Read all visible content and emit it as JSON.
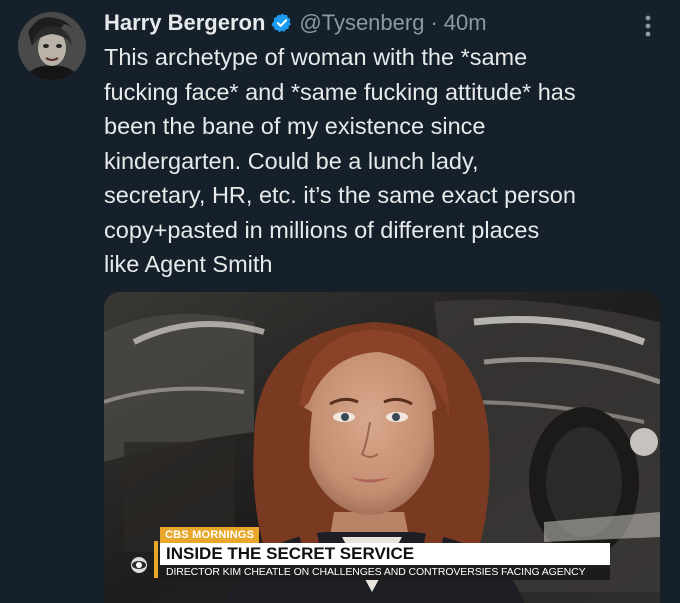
{
  "tweet": {
    "author": {
      "display_name": "Harry Bergeron",
      "handle": "@Tysenberg",
      "verified": true,
      "avatar_icon": "avatar-portrait"
    },
    "separator": "·",
    "timestamp": "40m",
    "more_icon": "more-vertical-icon",
    "text": "This archetype of woman with the *same\nfucking face* and *same fucking attitude* has\nbeen the bane of my existence since\nkindergarten. Could be a lunch lady,\nsecretary, HR, etc. it’s the same exact person\ncopy+pasted in millions of different places\nlike Agent Smith",
    "media": {
      "type": "video-still",
      "show_tag": "CBS MORNINGS",
      "headline": "INSIDE THE SECRET SERVICE",
      "subline": "DIRECTOR KIM CHEATLE ON CHALLENGES AND CONTROVERSIES FACING AGENCY"
    }
  },
  "colors": {
    "background": "#15202b",
    "text": "#e7e9ea",
    "muted": "#8b98a5",
    "verified": "#1d9bf0",
    "accent": "#e8a72b"
  }
}
